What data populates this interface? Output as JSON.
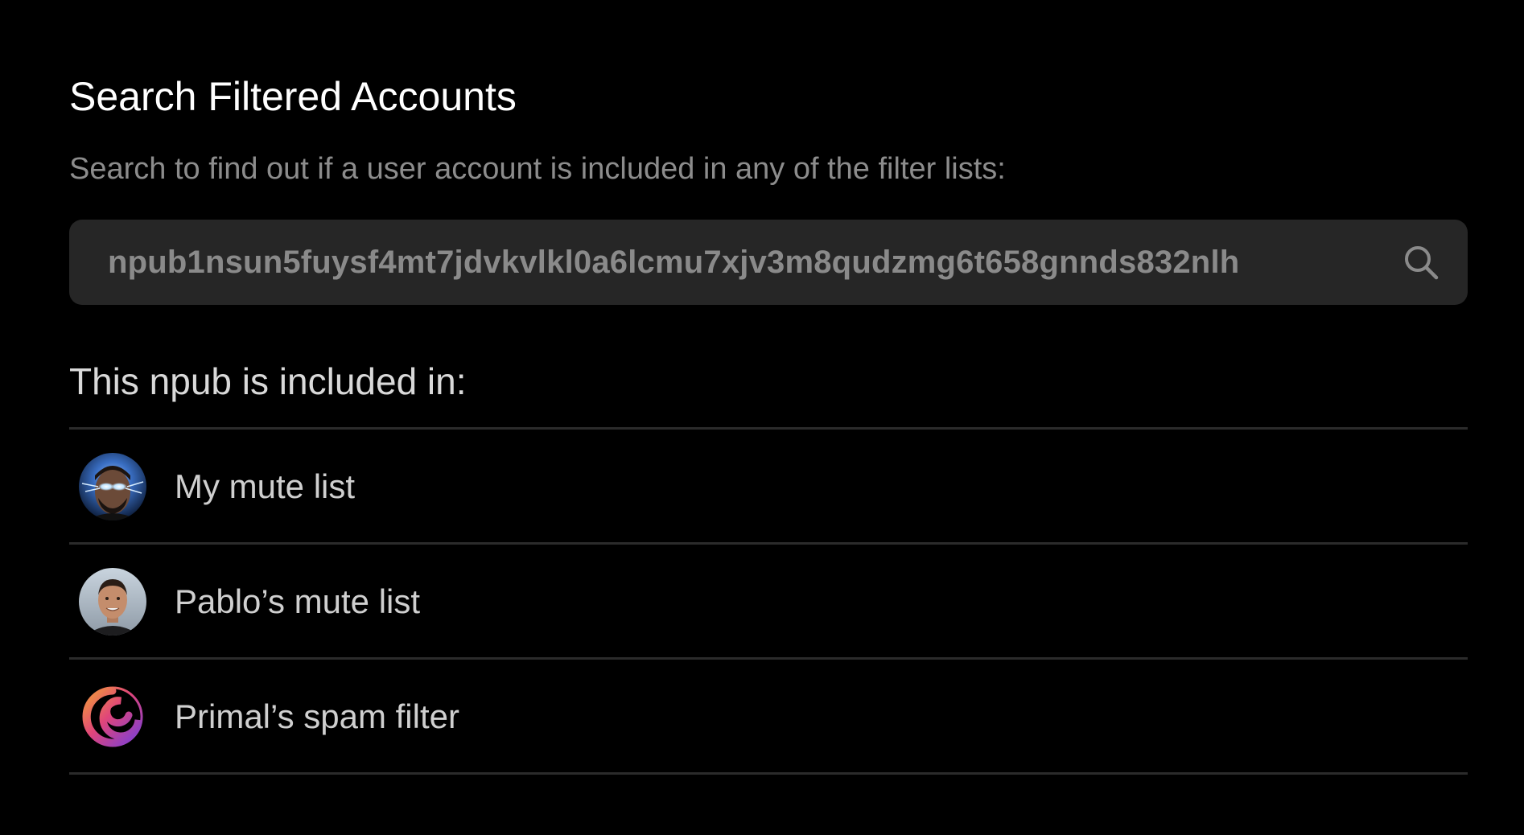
{
  "header": {
    "title": "Search Filtered Accounts",
    "subtitle": "Search to find out if a user account is included in any of the filter lists:"
  },
  "search": {
    "value": "npub1nsun5fuysf4mt7jdvkvlkl0a6lcmu7xjv3m8qudzmg6t658gnnds832nlh",
    "icon": "search-icon"
  },
  "results": {
    "heading": "This npub is included in:",
    "items": [
      {
        "label": "My mute list",
        "avatar": "user-avatar-glowing-eyes"
      },
      {
        "label": "Pablo’s mute list",
        "avatar": "user-avatar-pablo"
      },
      {
        "label": "Primal’s spam filter",
        "avatar": "primal-logo"
      }
    ]
  },
  "colors": {
    "background": "#000000",
    "title": "#ffffff",
    "subtitle": "#8c8c8c",
    "search_bg": "#262626",
    "search_text": "#8a8a8a",
    "divider": "#2b2b2b",
    "item_text": "#cfcfcf"
  }
}
